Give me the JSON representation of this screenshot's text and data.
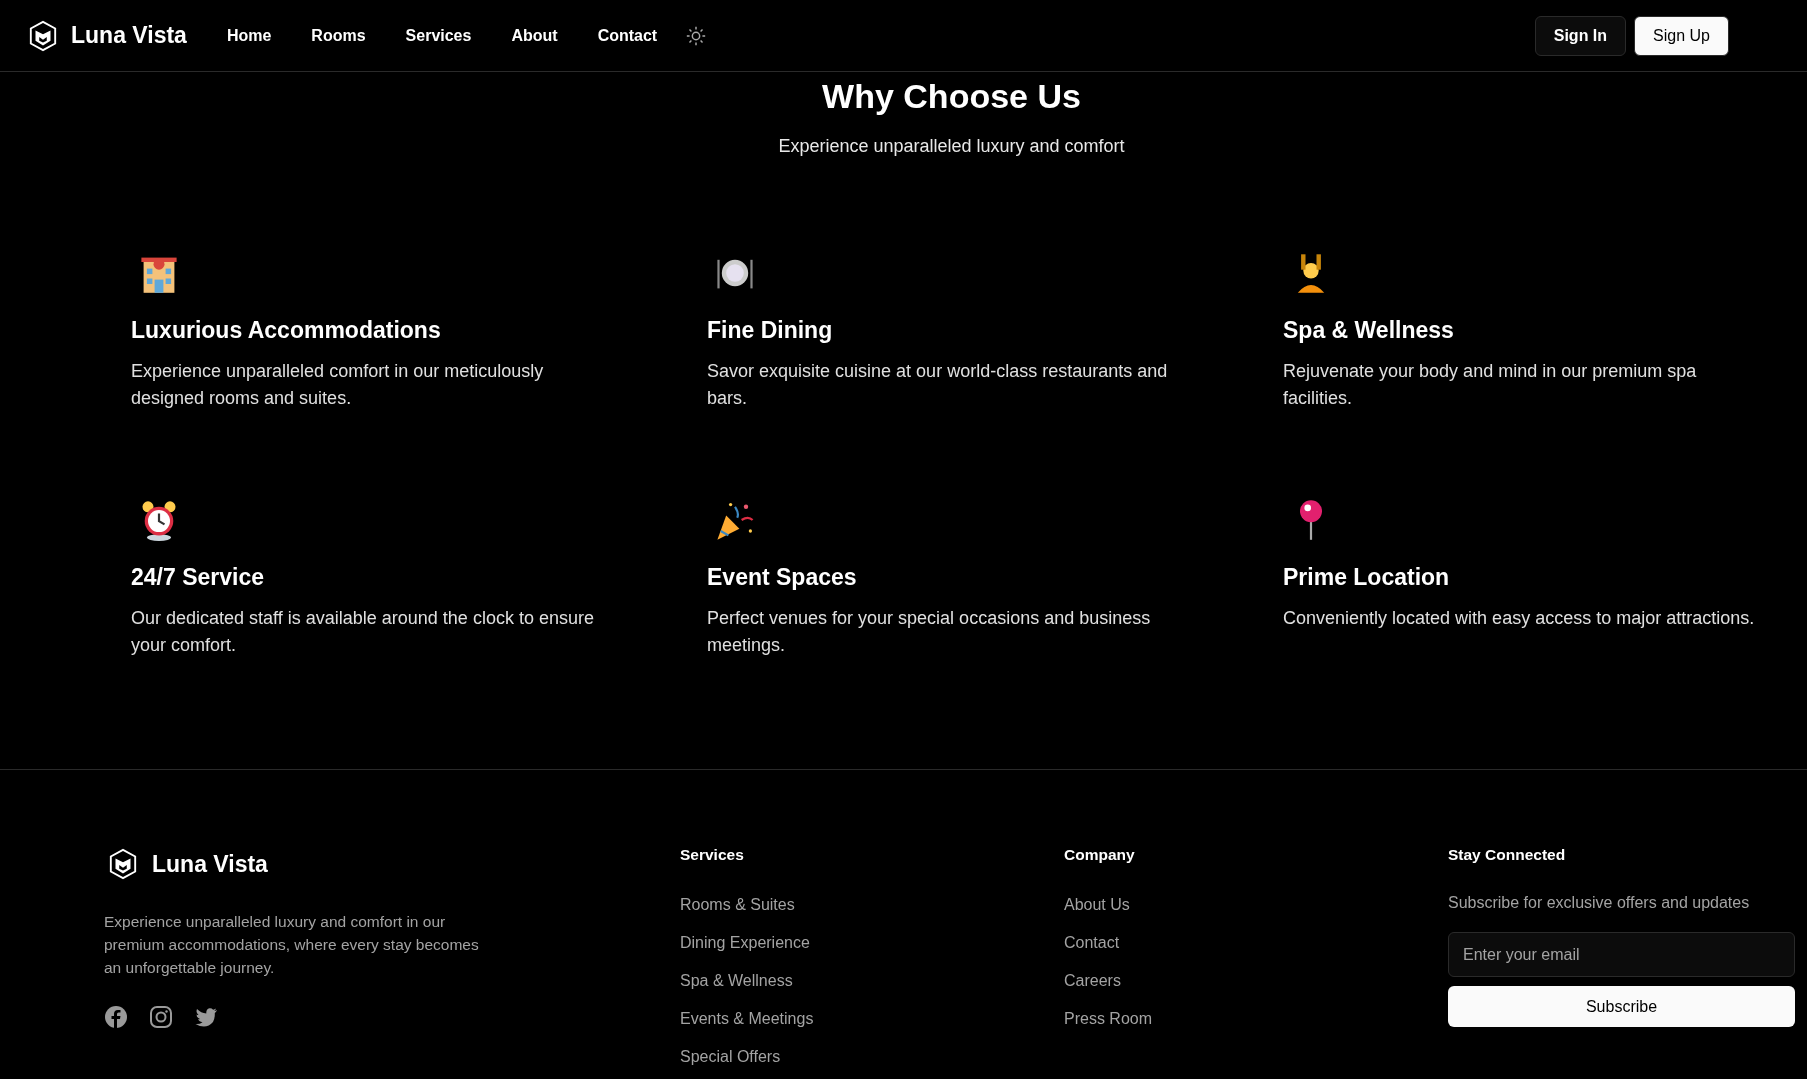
{
  "header": {
    "brand": "Luna Vista",
    "nav": [
      "Home",
      "Rooms",
      "Services",
      "About",
      "Contact"
    ],
    "buttons": [
      {
        "label": "Sign In",
        "kind": "secondary"
      },
      {
        "label": "Sign Up",
        "kind": "primary"
      }
    ]
  },
  "features_section": {
    "title": "Why Choose Us",
    "subtitle": "Experience unparalleled luxury and comfort",
    "features": [
      {
        "title": "Luxurious Accommodations",
        "description": "Experience unparalleled comfort in our meticulously designed rooms and suites."
      },
      {
        "title": "Fine Dining",
        "description": "Savor exquisite cuisine at our world-class restaurants and bars."
      },
      {
        "title": "Spa & Wellness",
        "description": "Rejuvenate your body and mind in our premium spa facilities."
      },
      {
        "title": "24/7 Service",
        "description": "Our dedicated staff is available around the clock to ensure your comfort."
      },
      {
        "title": "Event Spaces",
        "description": "Perfect venues for your special occasions and business meetings."
      },
      {
        "title": "Prime Location",
        "description": "Conveniently located with easy access to major attractions."
      }
    ]
  },
  "footer": {
    "brand": "Luna Vista",
    "about": "Experience unparalleled luxury and comfort in our premium accommodations, where every stay becomes an unforgettable journey.",
    "columns": [
      {
        "heading": "Services",
        "links": [
          "Rooms & Suites",
          "Dining Experience",
          "Spa & Wellness",
          "Events & Meetings",
          "Special Offers"
        ]
      },
      {
        "heading": "Company",
        "links": [
          "About Us",
          "Contact",
          "Careers",
          "Press Room"
        ]
      }
    ],
    "newsletter": {
      "heading": "Stay Connected",
      "text": "Subscribe for exclusive offers and updates",
      "placeholder": "Enter your email",
      "button": "Subscribe"
    }
  }
}
